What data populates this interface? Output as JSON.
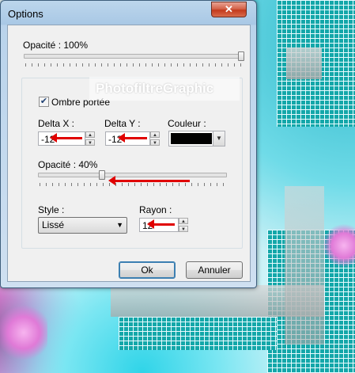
{
  "window": {
    "title": "Options",
    "close_label": "✕"
  },
  "opacity_main": {
    "label": "Opacité : 100%",
    "value_percent": 100
  },
  "watermark": "PhotofiltreGraphic",
  "shadow": {
    "checkbox_label": "Ombre portée",
    "checked": true,
    "delta_x": {
      "label": "Delta X :",
      "value": "-12"
    },
    "delta_y": {
      "label": "Delta Y :",
      "value": "-12"
    },
    "color": {
      "label": "Couleur :",
      "value": "#000000"
    },
    "opacity": {
      "label": "Opacité : 40%",
      "value_percent": 40
    },
    "style": {
      "label": "Style :",
      "selected": "Lissé"
    },
    "radius": {
      "label": "Rayon :",
      "value": "12"
    }
  },
  "buttons": {
    "ok": "Ok",
    "cancel": "Annuler"
  }
}
